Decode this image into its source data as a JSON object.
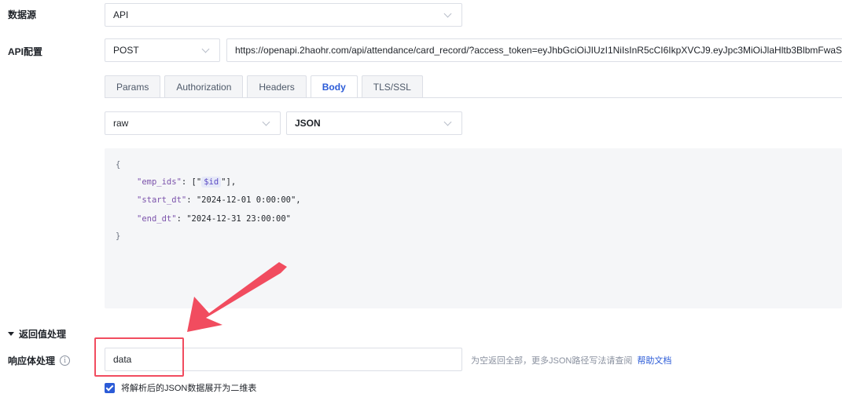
{
  "datasource": {
    "label": "数据源",
    "value": "API"
  },
  "api_config": {
    "label": "API配置",
    "method": "POST",
    "url": "https://openapi.2haohr.com/api/attendance/card_record/?access_token=eyJhbGciOiJIUzI1NiIsInR5cCI6IkpXVCJ9.eyJpc3MiOiJlaHltb3BlbmFwaSIsIm"
  },
  "tabs": [
    "Params",
    "Authorization",
    "Headers",
    "Body",
    "TLS/SSL"
  ],
  "active_tab": "Body",
  "body": {
    "mode": "raw",
    "format": "JSON",
    "code": {
      "open_brace": "{",
      "close_brace": "}",
      "emp_ids_key": "\"emp_ids\"",
      "emp_ids_pre": ": [\"",
      "emp_ids_var": "$id",
      "emp_ids_post": "\"],",
      "start_key": "\"start_dt\"",
      "start_val": ": \"2024-12-01 0:00:00\",",
      "end_key": "\"end_dt\"",
      "end_val": ": \"2024-12-31 23:00:00\""
    }
  },
  "return_section": {
    "title": "返回值处理"
  },
  "response": {
    "label": "响应体处理",
    "info_icon": "i",
    "value": "data",
    "hint": "为空返回全部，更多JSON路径写法请查阅",
    "help_link": "帮助文档"
  },
  "checkbox": {
    "label": "将解析后的JSON数据展开为二维表",
    "checked": true
  },
  "colors": {
    "accent": "#2b5bd7",
    "annotation": "#f14c5f"
  }
}
